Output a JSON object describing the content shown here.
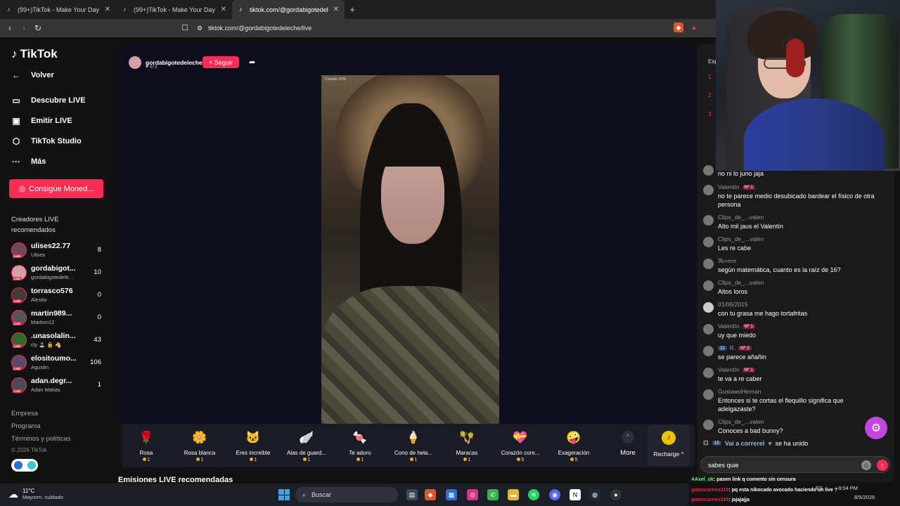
{
  "browser": {
    "tabs": [
      {
        "label": "(99+)TikTok - Make Your Day"
      },
      {
        "label": "(99+)TikTok - Make Your Day"
      },
      {
        "label": "tiktok.com/@gordabigotedel"
      }
    ],
    "url": "tiktok.com/@gordabigotedeleche/live"
  },
  "sidebar": {
    "logo": "TikTok",
    "back": "Volver",
    "nav": [
      {
        "label": "Descubre LIVE",
        "icon": "live-tv-icon"
      },
      {
        "label": "Emitir LIVE",
        "icon": "broadcast-icon"
      },
      {
        "label": "TikTok Studio",
        "icon": "studio-icon"
      },
      {
        "label": "Más",
        "icon": "more-dots-icon"
      }
    ],
    "coins_button": "Consigue Moned...",
    "section_title": "Creadores LIVE recomendados",
    "creators": [
      {
        "name": "ulises22.77",
        "sub": "Ulises",
        "count": "8"
      },
      {
        "name": "gordabigot...",
        "sub": "gordabigotedele...",
        "count": "10"
      },
      {
        "name": "torrasco576",
        "sub": "Alexito",
        "count": "0"
      },
      {
        "name": "martin989...",
        "sub": "Martinn12",
        "count": "0"
      },
      {
        "name": ".unasolalin...",
        "sub": "cly 🏝️ 🔒 🐴",
        "count": "43"
      },
      {
        "name": "elositoumo...",
        "sub": "Agustin",
        "count": "106"
      },
      {
        "name": "adan.degr...",
        "sub": "Adan Matias",
        "count": "1"
      }
    ],
    "live_badge": "LIVE",
    "footer": [
      "Empresa",
      "Programa",
      "Términos y políticas"
    ],
    "copyright": "© 2026 TikTok"
  },
  "stream": {
    "host_name": "gordabigotedeleche",
    "likes": "473",
    "follow_label": "+ Seguir",
    "creator_tag": "Creador LIVE",
    "watermark": "gordabigotedeleche"
  },
  "gifts": [
    {
      "name": "Rosa",
      "price": "1",
      "icon": "🌹"
    },
    {
      "name": "Rosa blanca",
      "price": "1",
      "icon": "🌼"
    },
    {
      "name": "Eres increíble",
      "price": "1",
      "icon": "🐱"
    },
    {
      "name": "Alas de guard...",
      "price": "1",
      "icon": "🪽"
    },
    {
      "name": "Te adoro",
      "price": "1",
      "icon": "🍬"
    },
    {
      "name": "Cono de hela...",
      "price": "1",
      "icon": "🍦"
    },
    {
      "name": "Maracas",
      "price": "1",
      "icon": "🪇"
    },
    {
      "name": "Corazón core...",
      "price": "5",
      "icon": "💝"
    },
    {
      "name": "Exageración",
      "price": "5",
      "icon": "🤪"
    }
  ],
  "gift_more": "More",
  "recharge": "Recharge ^",
  "recommended_title": "Emisiones LIVE recomendadas",
  "chat": {
    "rank_label": "Esp",
    "ranks": [
      "1",
      "2",
      "3"
    ],
    "messages": [
      {
        "user": "",
        "badge": "",
        "text": "no ni lo juno jaja"
      },
      {
        "user": "Valentín",
        "badge": "Nº 1",
        "text": "no te parece medio desubicado bardear el físico de otra persona"
      },
      {
        "user": "Clips_de_...valen",
        "badge": "",
        "text": "Alto mil jaus el Valentín"
      },
      {
        "user": "Clips_de_...valen",
        "badge": "",
        "text": "Les re cabe"
      },
      {
        "user": "ℜ𝔢𝔢𝔫𝔫𝔫",
        "badge": "",
        "text": "según matemática, cuanto es la raíz de 16?"
      },
      {
        "user": "Clips_de_...valen",
        "badge": "",
        "text": "Altos loros"
      },
      {
        "user": "01/06/2015",
        "badge": "",
        "text": "con tu grasa me hago tortafritas"
      },
      {
        "user": "Valentín",
        "badge": "Nº 1",
        "text": "uy que miedo"
      },
      {
        "user": "R.",
        "badge": "Nº 3",
        "text": "se parece añañin"
      },
      {
        "user": "Valentín",
        "badge": "Nº 1",
        "text": "te va a re caber"
      },
      {
        "user": "GustawoHernan",
        "badge": "",
        "text": "Entonces si te cortas el flequillo significa que adelgazaste?"
      },
      {
        "user": "Clips_de_...valen",
        "badge": "",
        "text": "Conoces a bad bunny?"
      }
    ],
    "joined": {
      "level": "15",
      "name": "Vai a correrel",
      "suffix": "se ha unido"
    },
    "input_value": "sabes quie"
  },
  "overlay_chat": [
    {
      "user": "AAxel_ok",
      "text": ": pasen link q comento sin censura"
    },
    {
      "user": "gatoncarnes310",
      "text": ": pq esta nikocado avocado haciendo un live ?"
    },
    {
      "user": "gatoncarnes310",
      "text": ": jajajajja"
    }
  ],
  "taskbar": {
    "temp": "11°C",
    "weather": "Mayorm. nublado",
    "search": "Buscar",
    "lang": "ES",
    "time": "8:04 PM",
    "date": "8/5/2026"
  },
  "colors": {
    "accent": "#fe2c55",
    "fab": "#c247e0",
    "coin": "#f2c000"
  }
}
